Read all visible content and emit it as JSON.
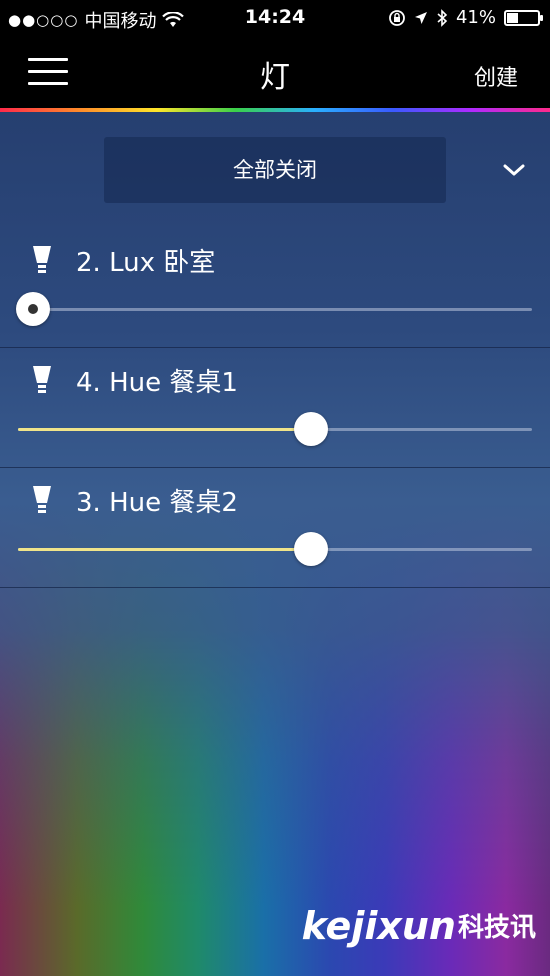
{
  "status_bar": {
    "signal": "●●○○○",
    "carrier": "中国移动",
    "time": "14:24",
    "battery": "41%",
    "battery_level": 0.41
  },
  "nav": {
    "title": "灯",
    "create_label": "创建"
  },
  "group_control": {
    "all_off_label": "全部关闭"
  },
  "lights": [
    {
      "name": "2. Lux 卧室",
      "on": false,
      "brightness": 0.0
    },
    {
      "name": "4. Hue 餐桌1",
      "on": true,
      "brightness": 0.57
    },
    {
      "name": "3. Hue 餐桌2",
      "on": true,
      "brightness": 0.57
    }
  ],
  "watermark": {
    "text": "kejixun",
    "cn": "科技讯"
  },
  "colors": {
    "accent_rainbow": [
      "#ff2a4a",
      "#ffe62a",
      "#3ad04a",
      "#2ab0ff",
      "#b02aff"
    ],
    "slider_fill": "#f0e48a"
  }
}
